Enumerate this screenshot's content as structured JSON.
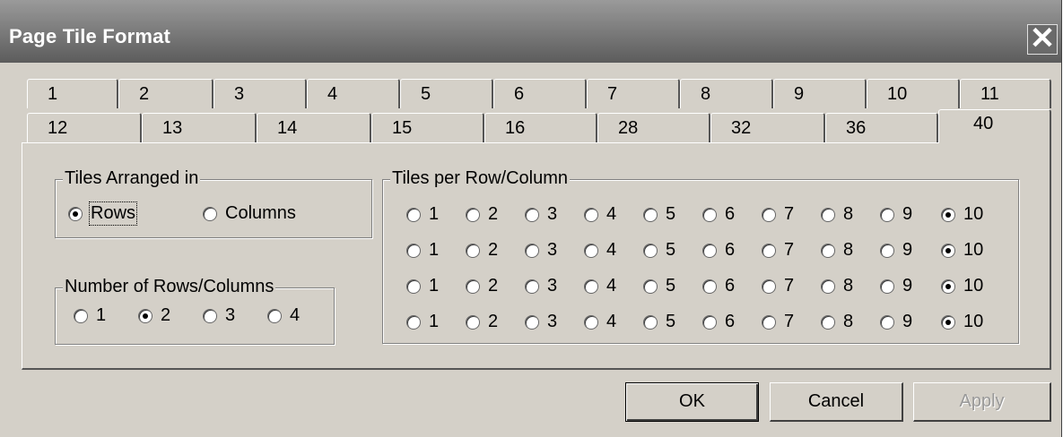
{
  "window": {
    "title": "Page Tile Format",
    "close_label": "✕"
  },
  "tabs_row1": [
    "1",
    "2",
    "3",
    "4",
    "5",
    "6",
    "7",
    "8",
    "9",
    "10",
    "11"
  ],
  "tabs_row2": [
    "12",
    "13",
    "14",
    "15",
    "16",
    "28",
    "32",
    "36",
    "40"
  ],
  "active_tab": "40",
  "arranged": {
    "legend": "Tiles Arranged in",
    "options": [
      "Rows",
      "Columns"
    ],
    "selected": "Rows"
  },
  "number": {
    "legend": "Number of Rows/Columns",
    "options": [
      "1",
      "2",
      "3",
      "4"
    ],
    "selected": "2"
  },
  "tiles_per": {
    "legend": "Tiles per Row/Column",
    "options": [
      "1",
      "2",
      "3",
      "4",
      "5",
      "6",
      "7",
      "8",
      "9",
      "10"
    ],
    "rows": [
      {
        "selected": "10"
      },
      {
        "selected": "10"
      },
      {
        "selected": "10"
      },
      {
        "selected": "10"
      }
    ]
  },
  "buttons": {
    "ok": "OK",
    "cancel": "Cancel",
    "apply": "Apply"
  },
  "icons": {
    "close": "close-icon"
  }
}
